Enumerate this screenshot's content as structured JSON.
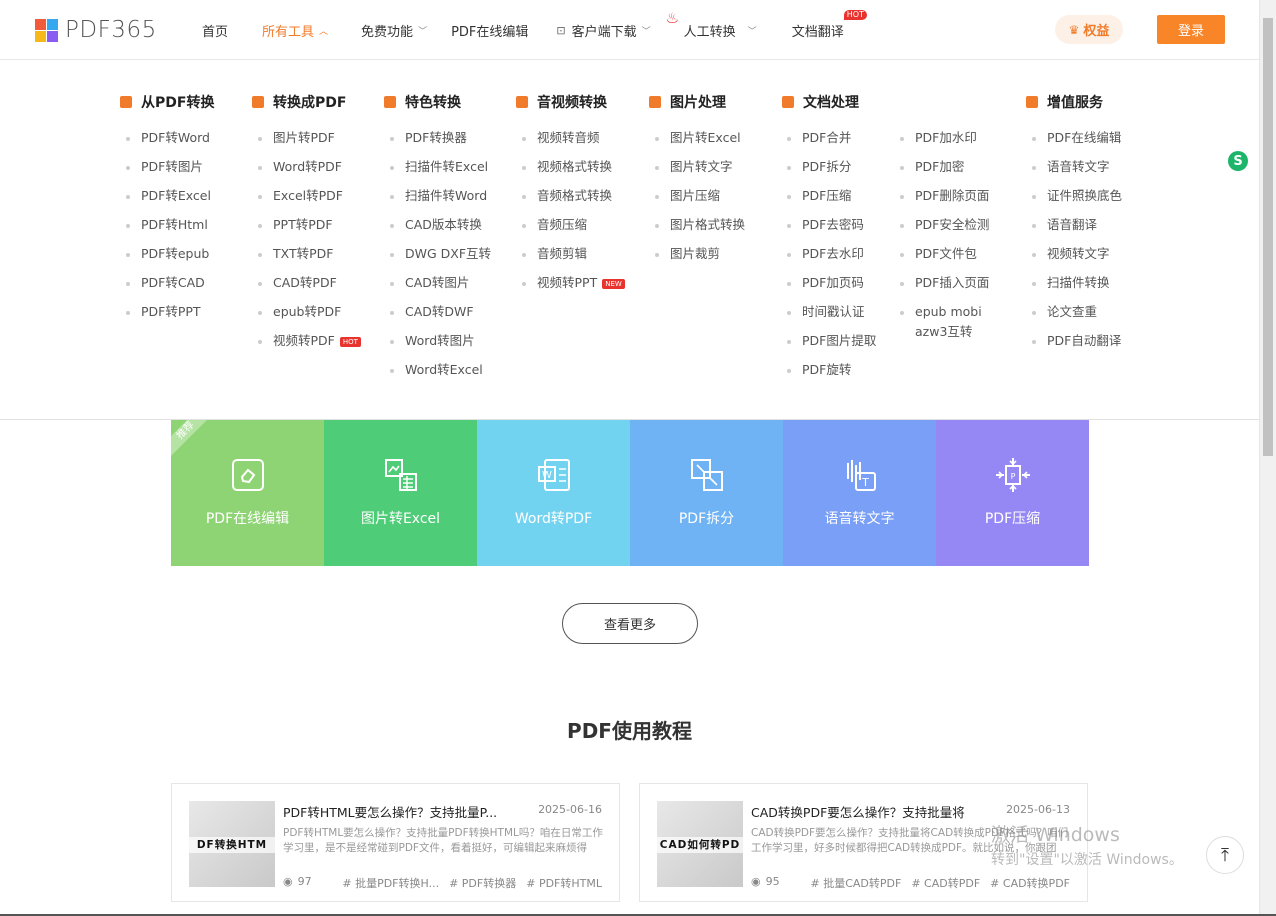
{
  "header": {
    "logo_text": "PDF365",
    "nav": [
      {
        "label": "首页"
      },
      {
        "label": "所有工具"
      },
      {
        "label": "免费功能"
      },
      {
        "label": "PDF在线编辑"
      },
      {
        "label": "客户端下载"
      },
      {
        "label": "人工转换"
      },
      {
        "label": "文档翻译"
      }
    ],
    "hot_badge": "HOT",
    "rights_label": "权益",
    "login_label": "登录"
  },
  "menu": {
    "columns": [
      {
        "title": "从PDF转换",
        "color": "#f07b2b",
        "items": [
          "PDF转Word",
          "PDF转图片",
          "PDF转Excel",
          "PDF转Html",
          "PDF转epub",
          "PDF转CAD",
          "PDF转PPT"
        ]
      },
      {
        "title": "转换成PDF",
        "color": "#f07b2b",
        "items": [
          "图片转PDF",
          "Word转PDF",
          "Excel转PDF",
          "PPT转PDF",
          "TXT转PDF",
          "CAD转PDF",
          "epub转PDF",
          "视频转PDF"
        ]
      },
      {
        "title": "特色转换",
        "color": "#f07b2b",
        "items": [
          "PDF转换器",
          "扫描件转Excel",
          "扫描件转Word",
          "CAD版本转换",
          "DWG DXF互转",
          "CAD转图片",
          "CAD转DWF",
          "Word转图片",
          "Word转Excel"
        ]
      },
      {
        "title": "音视频转换",
        "color": "#f07b2b",
        "items": [
          "视频转音频",
          "视频格式转换",
          "音频格式转换",
          "音频压缩",
          "音频剪辑",
          "视频转PPT"
        ]
      },
      {
        "title": "图片处理",
        "color": "#f07b2b",
        "items": [
          "图片转Excel",
          "图片转文字",
          "图片压缩",
          "图片格式转换",
          "图片裁剪"
        ]
      },
      {
        "title": "文档处理",
        "color": "#f07b2b",
        "items": [
          "PDF合并",
          "PDF拆分",
          "PDF压缩",
          "PDF去密码",
          "PDF去水印",
          "PDF加页码",
          "时间戳认证",
          "PDF图片提取",
          "PDF旋转"
        ]
      },
      {
        "title": "",
        "color": "#f07b2b",
        "items": [
          "PDF加水印",
          "PDF加密",
          "PDF删除页面",
          "PDF安全检测",
          "PDF文件包",
          "PDF插入页面",
          "epub mobi azw3互转"
        ]
      },
      {
        "title": "增值服务",
        "color": "#f07b2b",
        "items": [
          "PDF在线编辑",
          "语音转文字",
          "证件照换底色",
          "语音翻译",
          "视频转文字",
          "扫描件转换",
          "论文查重",
          "PDF自动翻译"
        ]
      }
    ],
    "hot_tag": "HOT",
    "new_tag": "NEW"
  },
  "tiles": [
    {
      "label": "PDF在线编辑",
      "color": "#8ed474",
      "icon": "edit-icon"
    },
    {
      "label": "图片转Excel",
      "color": "#4fcc77",
      "icon": "image-to-excel-icon"
    },
    {
      "label": "Word转PDF",
      "color": "#72d3f1",
      "icon": "word-icon"
    },
    {
      "label": "PDF拆分",
      "color": "#6fb3f4",
      "icon": "split-icon"
    },
    {
      "label": "语音转文字",
      "color": "#7a9ff6",
      "icon": "speech-to-text-icon"
    },
    {
      "label": "PDF压缩",
      "color": "#9588f5",
      "icon": "compress-icon"
    }
  ],
  "ribbon_label": "推荐",
  "more_label": "查看更多",
  "tutorial_title": "PDF使用教程",
  "articles": [
    {
      "title": "PDF转HTML要怎么操作？支持批量P...",
      "date": "2025-06-16",
      "desc": "PDF转HTML要怎么操作？支持批量PDF转换HTML吗？咱在日常工作学习里，是不是经常碰到PDF文件，看着挺好，可编辑起来麻烦得很?...",
      "views": "97",
      "tags": [
        "# 批量PDF转换H...",
        "# PDF转换器",
        "# PDF转HTML"
      ],
      "thumb_text": "DF转换HTM"
    },
    {
      "title": "CAD转换PDF要怎么操作？支持批量将...",
      "date": "2025-06-13",
      "desc": "CAD转换PDF要怎么操作？支持批量将CAD转换成PDF格式吗？咱们工作学习里，好多时候都得把CAD转换成PDF。就比如说，你跟团队...",
      "views": "95",
      "tags": [
        "# 批量CAD转PDF",
        "# CAD转PDF",
        "# CAD转换PDF"
      ],
      "thumb_text": "CAD如何转PD"
    }
  ],
  "watermark": {
    "line1": "激活 Windows",
    "line2": "转到\"设置\"以激活 Windows。"
  }
}
